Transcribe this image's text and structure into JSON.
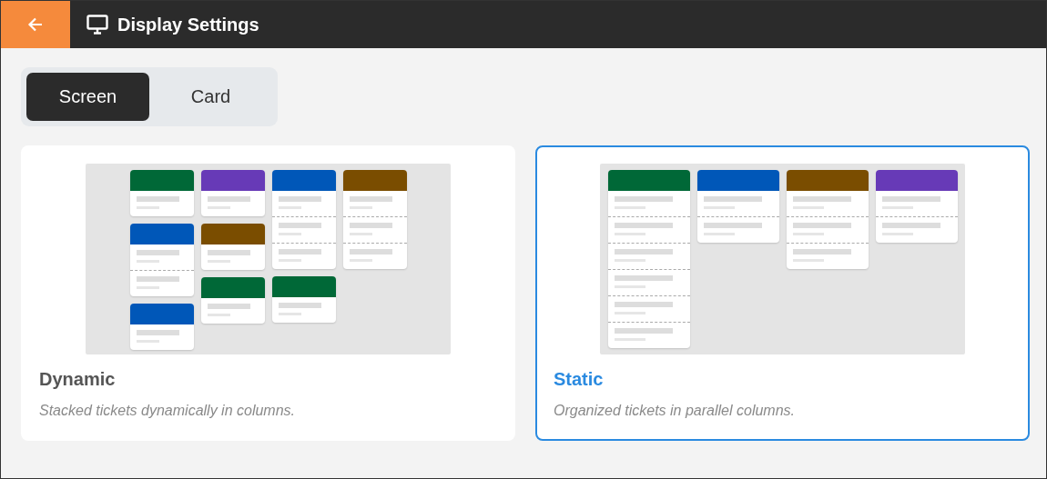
{
  "header": {
    "title": "Display Settings"
  },
  "tabs": [
    {
      "label": "Screen",
      "selected": true
    },
    {
      "label": "Card",
      "selected": false
    }
  ],
  "options": [
    {
      "kind": "dynamic",
      "title": "Dynamic",
      "description": "Stacked tickets dynamically in columns.",
      "selected": false
    },
    {
      "kind": "static",
      "title": "Static",
      "description": "Organized tickets in parallel columns.",
      "selected": true
    }
  ]
}
